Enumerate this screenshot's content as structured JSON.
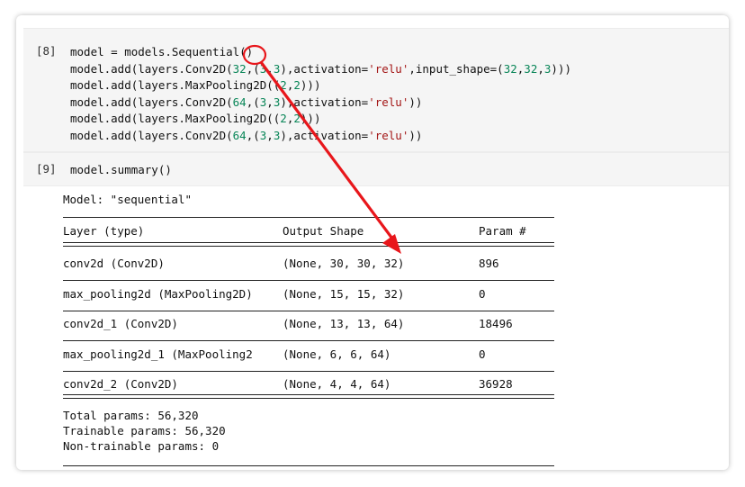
{
  "cell8": {
    "prompt": "[8]",
    "lines": [
      [
        "model = models.Sequential()"
      ],
      [
        "model.add(layers.Conv2D(",
        "32",
        ",(",
        "3",
        ",",
        "3",
        "),activation=",
        "'relu'",
        ",input_shape=(",
        "32",
        ",",
        "32",
        ",",
        "3",
        ")))"
      ],
      [
        "model.add(layers.MaxPooling2D((",
        "2",
        ",",
        "2",
        ")))"
      ],
      [
        "model.add(layers.Conv2D(",
        "64",
        ",(",
        "3",
        ",",
        "3",
        "),activation=",
        "'relu'",
        "))"
      ],
      [
        "model.add(layers.MaxPooling2D((",
        "2",
        ",",
        "2",
        ")))"
      ],
      [
        "model.add(layers.Conv2D(",
        "64",
        ",(",
        "3",
        ",",
        "3",
        "),activation=",
        "'relu'",
        "))"
      ]
    ]
  },
  "cell9": {
    "prompt": "[9]",
    "code": "model.summary()"
  },
  "summary": {
    "model_line": "Model: \"sequential\"",
    "headers": {
      "layer": "Layer (type)",
      "output": "Output Shape",
      "params": "Param #"
    },
    "rows": [
      {
        "layer": "conv2d (Conv2D)",
        "output": "(None, 30, 30, 32)",
        "params": "896"
      },
      {
        "layer": "max_pooling2d (MaxPooling2D)",
        "output": "(None, 15, 15, 32)",
        "params": "0"
      },
      {
        "layer": "conv2d_1 (Conv2D)",
        "output": "(None, 13, 13, 64)",
        "params": "18496"
      },
      {
        "layer": "max_pooling2d_1 (MaxPooling2",
        "output": "(None, 6, 6, 64)",
        "params": "0"
      },
      {
        "layer": "conv2d_2 (Conv2D)",
        "output": "(None, 4, 4, 64)",
        "params": "36928"
      }
    ],
    "total": "Total params: 56,320",
    "trainable": "Trainable params: 56,320",
    "non_trainable": "Non-trainable params: 0"
  },
  "annotation": {
    "color": "#e8161b"
  },
  "colors": {
    "number": "#098658",
    "string": "#a31515",
    "cell_bg": "#f5f5f5"
  }
}
